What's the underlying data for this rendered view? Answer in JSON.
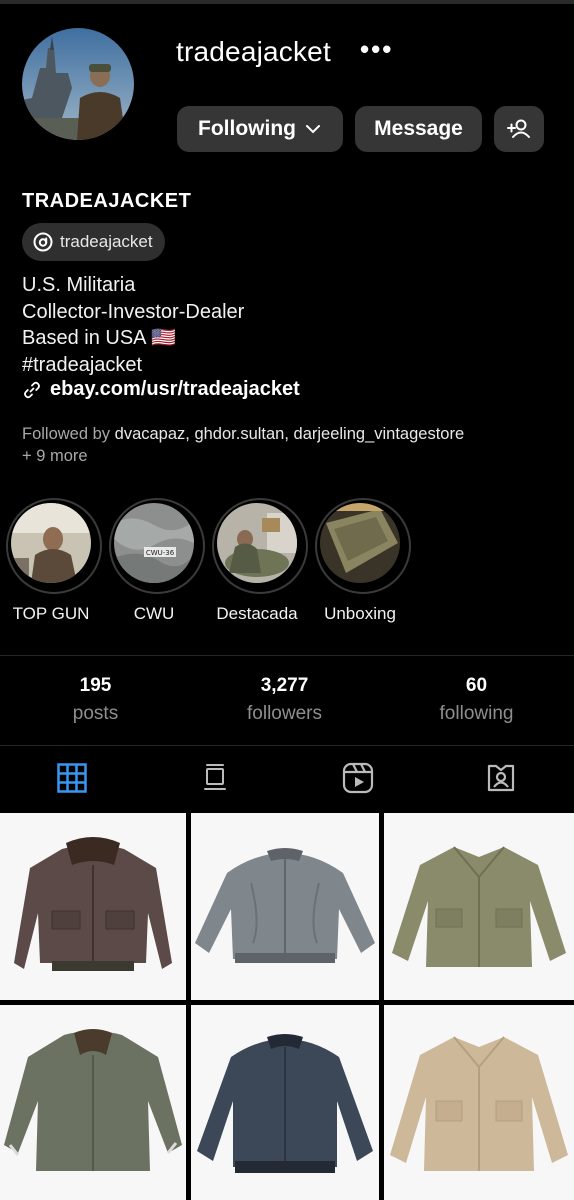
{
  "profile": {
    "username": "tradeajacket",
    "display_name": "TRADEAJACKET",
    "threads_handle": "tradeajacket",
    "bio": [
      "U.S. Militaria",
      "Collector-Investor-Dealer",
      "Based in USA 🇺🇸",
      "#tradeajacket"
    ],
    "link": "ebay.com/usr/tradeajacket",
    "followed_by_prefix": "Followed by",
    "followed_by_names": "dvacapaz, ghdor.sultan, darjeeling_vintagestore",
    "followed_by_more": "+ 9 more"
  },
  "actions": {
    "following_label": "Following",
    "message_label": "Message"
  },
  "highlights": [
    {
      "label": "TOP GUN"
    },
    {
      "label": "CWU"
    },
    {
      "label": "Destacada"
    },
    {
      "label": "Unboxing"
    }
  ],
  "stats": [
    {
      "value": "195",
      "label": "posts"
    },
    {
      "value": "3,277",
      "label": "followers"
    },
    {
      "value": "60",
      "label": "following"
    }
  ],
  "tabs": [
    {
      "icon": "grid-icon",
      "active": true
    },
    {
      "icon": "guide-icon",
      "active": false
    },
    {
      "icon": "reels-icon",
      "active": false
    },
    {
      "icon": "tagged-icon",
      "active": false
    }
  ],
  "highlight_tag": "CWU-36",
  "colors": {
    "background": "#000000",
    "button": "#363636",
    "active_tab": "#3897f0",
    "muted_text": "#8e8e8e"
  }
}
